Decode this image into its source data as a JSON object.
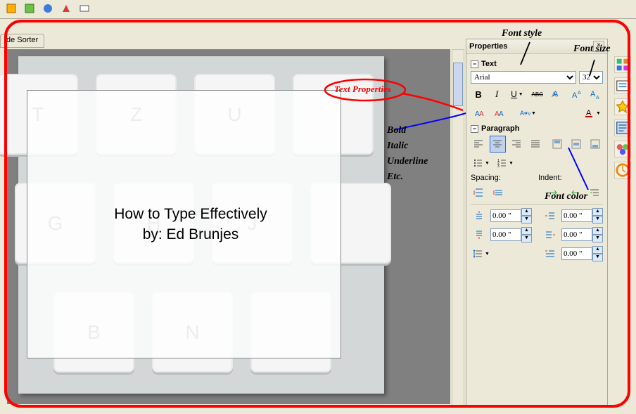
{
  "tab": {
    "sorter_label": "de Sorter"
  },
  "slide": {
    "title_line1": "How to Type Effectively",
    "title_line2": "by:  Ed Brunjes",
    "keys": [
      "T",
      "Z",
      "U",
      "G",
      "H",
      "J",
      "B",
      "N"
    ]
  },
  "panel": {
    "title": "Properties",
    "text_section": "Text",
    "paragraph_section": "Paragraph",
    "font_name": "Arial",
    "font_name_options": [
      "Arial"
    ],
    "font_size": "32",
    "font_size_options": [
      "32"
    ],
    "spacing_label": "Spacing:",
    "indent_label": "Indent:",
    "spin_val": "0.00 \""
  },
  "annotations": {
    "font_style": "Font style",
    "font_size": "Font size",
    "text_properties": "Text Properties",
    "style_list_1": "Bold",
    "style_list_2": "Italic",
    "style_list_3": "Underline",
    "style_list_4": "Etc.",
    "font_color": "Font color"
  },
  "icons": {
    "bold": "B",
    "italic": "I",
    "underline": "U",
    "strike": "ABC"
  }
}
